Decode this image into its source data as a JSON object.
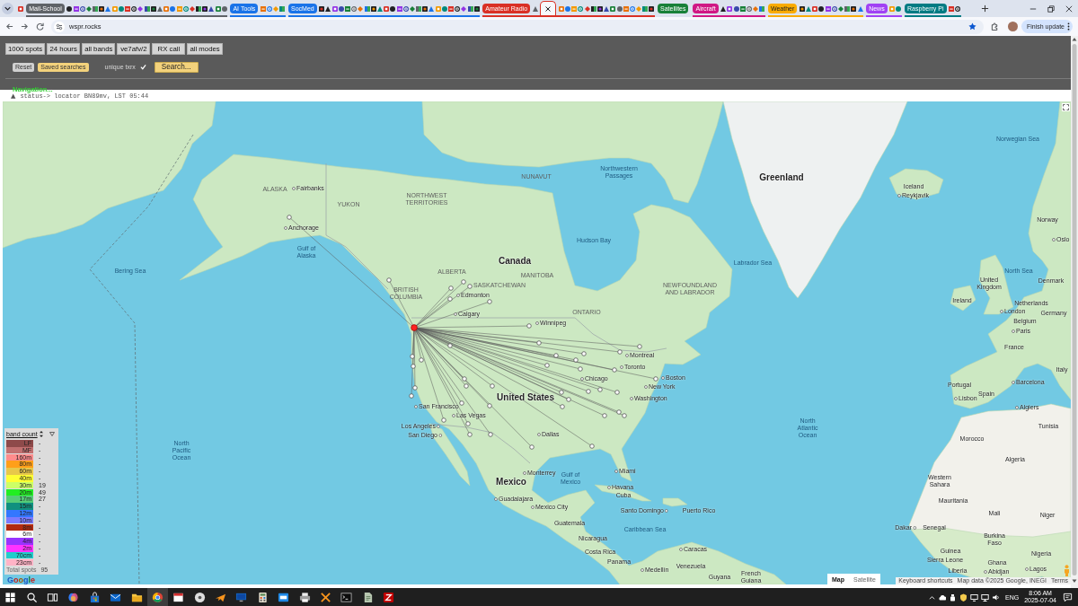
{
  "browser": {
    "tab_strip": [
      {
        "kind": "tab",
        "selected": false
      },
      {
        "kind": "group",
        "label": "Mail-School",
        "color": "#5f6368",
        "collapsed": false,
        "tabs": [
          {
            "selected": false
          },
          {
            "selected": false
          },
          {
            "selected": false
          },
          {
            "selected": false
          },
          {
            "selected": false
          },
          {
            "selected": false
          },
          {
            "selected": false
          },
          {
            "selected": false
          },
          {
            "selected": false
          },
          {
            "selected": false
          },
          {
            "selected": false
          },
          {
            "selected": false
          },
          {
            "selected": false
          },
          {
            "selected": false
          },
          {
            "selected": false
          },
          {
            "selected": false
          },
          {
            "selected": false
          },
          {
            "selected": false
          },
          {
            "selected": false
          },
          {
            "selected": false
          },
          {
            "selected": false
          },
          {
            "selected": false
          },
          {
            "selected": false
          },
          {
            "selected": false
          },
          {
            "selected": false
          }
        ]
      },
      {
        "kind": "group",
        "label": "AI Tools",
        "color": "#1a73e8",
        "collapsed": false,
        "tabs": [
          {
            "selected": false
          },
          {
            "selected": false
          },
          {
            "selected": false
          },
          {
            "selected": false
          }
        ]
      },
      {
        "kind": "group",
        "label": "SocMed",
        "color": "#1a73e8",
        "collapsed": false,
        "tabs": [
          {
            "selected": false
          },
          {
            "selected": false
          },
          {
            "selected": false
          },
          {
            "selected": false
          },
          {
            "selected": false
          },
          {
            "selected": false
          },
          {
            "selected": false
          },
          {
            "selected": false
          },
          {
            "selected": false
          },
          {
            "selected": false
          },
          {
            "selected": false
          },
          {
            "selected": false
          },
          {
            "selected": false
          },
          {
            "selected": false
          },
          {
            "selected": false
          },
          {
            "selected": false
          },
          {
            "selected": false
          },
          {
            "selected": false
          },
          {
            "selected": false
          },
          {
            "selected": false
          },
          {
            "selected": false
          },
          {
            "selected": false
          },
          {
            "selected": false
          },
          {
            "selected": false
          },
          {
            "selected": false
          }
        ]
      },
      {
        "kind": "group",
        "label": "Amateur Radio",
        "color": "#d93025",
        "collapsed": false,
        "tabs": [
          {
            "selected": false
          },
          {
            "selected": true
          },
          {
            "selected": false
          },
          {
            "selected": false
          },
          {
            "selected": false
          },
          {
            "selected": false
          },
          {
            "selected": false
          },
          {
            "selected": false
          },
          {
            "selected": false
          },
          {
            "selected": false
          },
          {
            "selected": false
          },
          {
            "selected": false
          },
          {
            "selected": false
          },
          {
            "selected": false
          },
          {
            "selected": false
          },
          {
            "selected": false
          },
          {
            "selected": false
          }
        ]
      },
      {
        "kind": "group",
        "label": "Satellites",
        "color": "#188038",
        "collapsed": true
      },
      {
        "kind": "group",
        "label": "Aircraft",
        "color": "#d01884",
        "collapsed": false,
        "tabs": [
          {
            "selected": false
          },
          {
            "selected": false
          },
          {
            "selected": false
          },
          {
            "selected": false
          },
          {
            "selected": false
          },
          {
            "selected": false
          },
          {
            "selected": false
          }
        ]
      },
      {
        "kind": "group",
        "label": "Weather",
        "color": "#f9ab00",
        "collapsed": false,
        "tabs": [
          {
            "selected": false
          },
          {
            "selected": false
          },
          {
            "selected": false
          },
          {
            "selected": false
          },
          {
            "selected": false
          },
          {
            "selected": false
          },
          {
            "selected": false
          },
          {
            "selected": false
          },
          {
            "selected": false
          },
          {
            "selected": false
          }
        ]
      },
      {
        "kind": "group",
        "label": "News",
        "color": "#a142f4",
        "collapsed": false,
        "tabs": [
          {
            "selected": false
          },
          {
            "selected": false
          }
        ]
      },
      {
        "kind": "group",
        "label": "Raspberry Pi",
        "color": "#007b83",
        "collapsed": false,
        "tabs": [
          {
            "selected": false
          },
          {
            "selected": false
          }
        ]
      }
    ],
    "address": {
      "url": "wspr.rocks",
      "bookmarked": true
    },
    "update_button": "Finish update"
  },
  "page": {
    "filters": [
      "1000 spots",
      "24 hours",
      "all bands",
      "ve7afv/2",
      "RX call",
      "all modes"
    ],
    "actions": [
      {
        "kind": "minor",
        "label": "Reset"
      },
      {
        "kind": "minor-accent",
        "label": "Saved searches"
      },
      {
        "kind": "toggle",
        "label": "unique txrx",
        "checked": true
      },
      {
        "kind": "major-accent",
        "label": "Search..."
      }
    ],
    "navigation": "Navigation...",
    "status": {
      "toggle": "▲",
      "text": "status-> locator BN89mv, LST 05:44"
    }
  },
  "map": {
    "labels": [
      {
        "kind": "water",
        "text": "Norwegian Sea"
      },
      {
        "kind": "region",
        "text": "NUNAVUT"
      },
      {
        "kind": "water",
        "text": "Northwestern Passages"
      },
      {
        "kind": "major",
        "text": "Greenland"
      },
      {
        "kind": "region",
        "text": "ALASKA"
      },
      {
        "kind": "city",
        "text": "Fairbanks"
      },
      {
        "kind": "region",
        "text": "YUKON"
      },
      {
        "kind": "region",
        "text": "NORTHWEST TERRITORIES"
      },
      {
        "kind": "country",
        "text": "Iceland"
      },
      {
        "kind": "city",
        "text": "Reykjavik"
      },
      {
        "kind": "country",
        "text": "Norway"
      },
      {
        "kind": "city",
        "text": "Anchorage"
      },
      {
        "kind": "water",
        "text": "Hudson Bay"
      },
      {
        "kind": "city",
        "text": "Oslo"
      },
      {
        "kind": "water",
        "text": "Gulf of Alaska"
      },
      {
        "kind": "major",
        "text": "Canada"
      },
      {
        "kind": "water",
        "text": "Labrador Sea"
      },
      {
        "kind": "water",
        "text": "Bering Sea"
      },
      {
        "kind": "region",
        "text": "ALBERTA"
      },
      {
        "kind": "region",
        "text": "MANITOBA"
      },
      {
        "kind": "water",
        "text": "North Sea"
      },
      {
        "kind": "region",
        "text": "SASKATCHEWAN"
      },
      {
        "kind": "country",
        "text": "United Kingdom"
      },
      {
        "kind": "country",
        "text": "Denmark"
      },
      {
        "kind": "region",
        "text": "BRITISH COLUMBIA"
      },
      {
        "kind": "city",
        "text": "Edmonton"
      },
      {
        "kind": "region",
        "text": "NEWFOUNDLAND AND LABRADOR"
      },
      {
        "kind": "country",
        "text": "Ireland"
      },
      {
        "kind": "country",
        "text": "Netherlands"
      },
      {
        "kind": "city",
        "text": "Calgary"
      },
      {
        "kind": "region",
        "text": "ONTARIO"
      },
      {
        "kind": "city",
        "text": "London"
      },
      {
        "kind": "country",
        "text": "Germany"
      },
      {
        "kind": "city",
        "text": "Winnipeg"
      },
      {
        "kind": "country",
        "text": "Belgium"
      },
      {
        "kind": "city",
        "text": "Paris"
      },
      {
        "kind": "country",
        "text": "France"
      },
      {
        "kind": "city",
        "text": "Montreal"
      },
      {
        "kind": "city",
        "text": "Toronto"
      },
      {
        "kind": "country",
        "text": "Italy"
      },
      {
        "kind": "city",
        "text": "Chicago"
      },
      {
        "kind": "city",
        "text": "Boston"
      },
      {
        "kind": "city",
        "text": "New York"
      },
      {
        "kind": "country",
        "text": "Portugal"
      },
      {
        "kind": "city",
        "text": "Barcelona"
      },
      {
        "kind": "major",
        "text": "United States"
      },
      {
        "kind": "city",
        "text": "Washington"
      },
      {
        "kind": "city",
        "text": "Lisbon"
      },
      {
        "kind": "country",
        "text": "Spain"
      },
      {
        "kind": "city",
        "text": "San Francisco"
      },
      {
        "kind": "city",
        "text": "Algiers"
      },
      {
        "kind": "city",
        "text": "Las Vegas"
      },
      {
        "kind": "city",
        "text": "Los Angeles"
      },
      {
        "kind": "water",
        "text": "North Atlantic Ocean"
      },
      {
        "kind": "country",
        "text": "Tunisia"
      },
      {
        "kind": "city",
        "text": "San Diego"
      },
      {
        "kind": "city",
        "text": "Dallas"
      },
      {
        "kind": "water",
        "text": "North Pacific Ocean"
      },
      {
        "kind": "country",
        "text": "Morocco"
      },
      {
        "kind": "country",
        "text": "Algeria"
      },
      {
        "kind": "city",
        "text": "Monterrey"
      },
      {
        "kind": "water",
        "text": "Gulf of Mexico"
      },
      {
        "kind": "city",
        "text": "Miami"
      },
      {
        "kind": "major",
        "text": "Mexico"
      },
      {
        "kind": "city",
        "text": "Havana"
      },
      {
        "kind": "country",
        "text": "Western Sahara"
      },
      {
        "kind": "city",
        "text": "Guadalajara"
      },
      {
        "kind": "country",
        "text": "Cuba"
      },
      {
        "kind": "city",
        "text": "Mexico City"
      },
      {
        "kind": "city",
        "text": "Santo Domingo"
      },
      {
        "kind": "country",
        "text": "Mauritania"
      },
      {
        "kind": "country",
        "text": "Puerto Rico"
      },
      {
        "kind": "country",
        "text": "Mali"
      },
      {
        "kind": "country",
        "text": "Niger"
      },
      {
        "kind": "country",
        "text": "Guatemala"
      },
      {
        "kind": "water",
        "text": "Caribbean Sea"
      },
      {
        "kind": "city",
        "text": "Dakar"
      },
      {
        "kind": "country",
        "text": "Senegal"
      },
      {
        "kind": "country",
        "text": "Nicaragua"
      },
      {
        "kind": "city",
        "text": "Caracas"
      },
      {
        "kind": "country",
        "text": "Burkina Faso"
      },
      {
        "kind": "country",
        "text": "Costa Rica"
      },
      {
        "kind": "country",
        "text": "Guinea"
      },
      {
        "kind": "country",
        "text": "Sierra Leone"
      },
      {
        "kind": "country",
        "text": "Nigeria"
      },
      {
        "kind": "country",
        "text": "Panama"
      },
      {
        "kind": "city",
        "text": "Medellín"
      },
      {
        "kind": "country",
        "text": "Venezuela"
      },
      {
        "kind": "country",
        "text": "Liberia"
      },
      {
        "kind": "country",
        "text": "Ghana"
      },
      {
        "kind": "country",
        "text": "Guyana"
      },
      {
        "kind": "country",
        "text": "French Guiana"
      },
      {
        "kind": "city",
        "text": "Abidjan"
      },
      {
        "kind": "city",
        "text": "Lagos"
      }
    ],
    "legend": {
      "title": "band count",
      "bands": [
        {
          "name": "LF",
          "count": "-",
          "color": "#8e4a4a"
        },
        {
          "name": "MF",
          "count": "-",
          "color": "#c27070"
        },
        {
          "name": "160m",
          "count": "-",
          "color": "#ff8c8c"
        },
        {
          "name": "80m",
          "count": "-",
          "color": "#ff9f1a"
        },
        {
          "name": "60m",
          "count": "-",
          "color": "#e8c84a"
        },
        {
          "name": "40m",
          "count": "-",
          "color": "#ffff33"
        },
        {
          "name": "30m",
          "count": "19",
          "color": "#ccff66"
        },
        {
          "name": "20m",
          "count": "49",
          "color": "#22ee22"
        },
        {
          "name": "17m",
          "count": "27",
          "color": "#55cc77"
        },
        {
          "name": "15m",
          "count": "-",
          "color": "#10907f"
        },
        {
          "name": "12m",
          "count": "-",
          "color": "#3377ff"
        },
        {
          "name": "10m",
          "count": "-",
          "color": "#7b7bff"
        },
        {
          "name": "8m",
          "count": "-",
          "color": "#b22a10"
        },
        {
          "name": "6m",
          "count": "-",
          "color": "#ffffff"
        },
        {
          "name": "4m",
          "count": "-",
          "color": "#9933ff"
        },
        {
          "name": "2m",
          "count": "-",
          "color": "#ff33ff"
        },
        {
          "name": "70cm",
          "count": "-",
          "color": "#22cccc"
        },
        {
          "name": "23cm",
          "count": "-",
          "color": "#ffb3c6"
        }
      ],
      "total_label": "Total spots",
      "total": "95"
    },
    "logo": "Google",
    "map_types": [
      {
        "label": "Map",
        "selected": true
      },
      {
        "label": "Satellite",
        "selected": false
      }
    ],
    "attribution": [
      "Keyboard shortcuts",
      "Map data ©2025 Google, INEGI",
      "Terms"
    ]
  },
  "taskbar": {
    "apps": [
      {
        "active": false
      },
      {
        "active": false
      },
      {
        "active": false
      },
      {
        "active": false
      },
      {
        "active": false
      },
      {
        "active": false
      },
      {
        "active": false
      },
      {
        "active": true
      },
      {
        "active": false
      },
      {
        "active": false
      },
      {
        "active": false
      },
      {
        "active": false
      },
      {
        "active": false
      },
      {
        "active": false
      },
      {
        "active": false
      },
      {
        "active": false
      },
      {
        "active": false
      },
      {
        "active": false
      },
      {
        "active": false
      }
    ],
    "language": "ENG",
    "time": "8:06 AM",
    "date": "2025-07-04"
  }
}
